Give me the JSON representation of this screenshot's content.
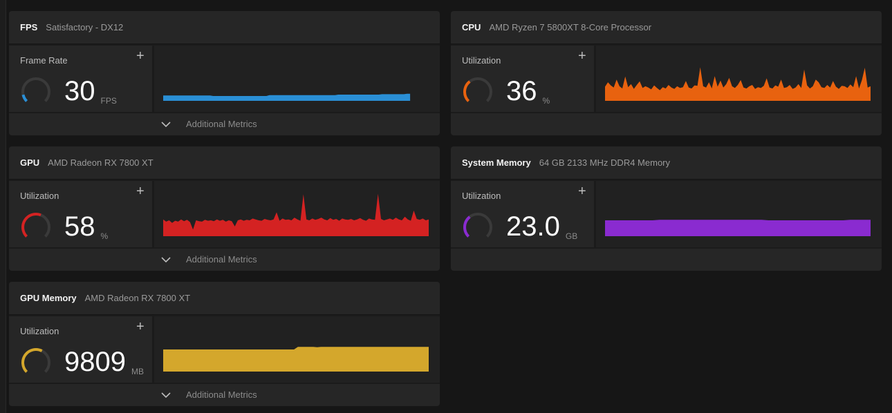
{
  "cards": {
    "fps": {
      "title": "FPS",
      "subtitle": "Satisfactory - DX12",
      "metric_label": "Frame Rate",
      "value": "30",
      "unit": "FPS",
      "gauge_fraction": 0.12,
      "color": "#2a8fd6",
      "graph_values": [
        0.12,
        0.12,
        0.12,
        0.12,
        0.12,
        0.12,
        0.12,
        0.12,
        0.12,
        0.12,
        0.12,
        0.12,
        0.12,
        0.12,
        0.12,
        0.12,
        0.11,
        0.11,
        0.11,
        0.11,
        0.11,
        0.11,
        0.11,
        0.11,
        0.11,
        0.11,
        0.11,
        0.11,
        0.11,
        0.11,
        0.11,
        0.11,
        0.11,
        0.11,
        0.13,
        0.13,
        0.13,
        0.13,
        0.13,
        0.13,
        0.13,
        0.13,
        0.13,
        0.13,
        0.13,
        0.13,
        0.13,
        0.13,
        0.13,
        0.13,
        0.13,
        0.13,
        0.13,
        0.13,
        0.13,
        0.13,
        0.14,
        0.14,
        0.14,
        0.14,
        0.14,
        0.14,
        0.14,
        0.14,
        0.14,
        0.14,
        0.14,
        0.14,
        0.14,
        0.14,
        0.15,
        0.15,
        0.15,
        0.15,
        0.15,
        0.15,
        0.15,
        0.15,
        0.16,
        0.16
      ],
      "graph_fill": 0.93,
      "has_footer": true
    },
    "cpu": {
      "title": "CPU",
      "subtitle": "AMD Ryzen 7 5800XT 8-Core Processor",
      "metric_label": "Utilization",
      "value": "36",
      "unit": "%",
      "gauge_fraction": 0.36,
      "color": "#e8620f",
      "graph_values": [
        0.32,
        0.42,
        0.35,
        0.3,
        0.48,
        0.33,
        0.28,
        0.55,
        0.31,
        0.38,
        0.27,
        0.36,
        0.44,
        0.29,
        0.33,
        0.3,
        0.26,
        0.35,
        0.29,
        0.24,
        0.31,
        0.28,
        0.36,
        0.3,
        0.27,
        0.33,
        0.29,
        0.31,
        0.45,
        0.3,
        0.28,
        0.35,
        0.34,
        0.76,
        0.33,
        0.3,
        0.42,
        0.28,
        0.56,
        0.32,
        0.46,
        0.3,
        0.38,
        0.52,
        0.33,
        0.29,
        0.36,
        0.47,
        0.3,
        0.28,
        0.33,
        0.36,
        0.27,
        0.31,
        0.29,
        0.34,
        0.51,
        0.3,
        0.28,
        0.35,
        0.32,
        0.48,
        0.29,
        0.31,
        0.36,
        0.27,
        0.3,
        0.38,
        0.29,
        0.71,
        0.35,
        0.28,
        0.33,
        0.48,
        0.42,
        0.31,
        0.29,
        0.36,
        0.3,
        0.45,
        0.32,
        0.27,
        0.34,
        0.33,
        0.29,
        0.37,
        0.31,
        0.56,
        0.28,
        0.47,
        0.75,
        0.3,
        0.33
      ],
      "graph_fill": 1.0,
      "has_footer": false
    },
    "gpu": {
      "title": "GPU",
      "subtitle": "AMD Radeon RX 7800 XT",
      "metric_label": "Utilization",
      "value": "58",
      "unit": "%",
      "gauge_fraction": 0.58,
      "color": "#d42222",
      "graph_values": [
        0.38,
        0.33,
        0.36,
        0.3,
        0.35,
        0.33,
        0.38,
        0.34,
        0.37,
        0.32,
        0.15,
        0.36,
        0.34,
        0.33,
        0.37,
        0.35,
        0.36,
        0.34,
        0.38,
        0.35,
        0.37,
        0.33,
        0.36,
        0.34,
        0.22,
        0.36,
        0.38,
        0.35,
        0.37,
        0.36,
        0.4,
        0.38,
        0.36,
        0.35,
        0.39,
        0.37,
        0.36,
        0.38,
        0.54,
        0.35,
        0.4,
        0.37,
        0.38,
        0.36,
        0.42,
        0.38,
        0.35,
        0.95,
        0.38,
        0.36,
        0.4,
        0.37,
        0.39,
        0.42,
        0.38,
        0.36,
        0.41,
        0.37,
        0.39,
        0.35,
        0.4,
        0.38,
        0.37,
        0.39,
        0.36,
        0.38,
        0.41,
        0.37,
        0.35,
        0.4,
        0.38,
        0.37,
        0.96,
        0.39,
        0.36,
        0.38,
        0.4,
        0.37,
        0.42,
        0.38,
        0.36,
        0.44,
        0.38,
        0.35,
        0.58,
        0.39,
        0.37,
        0.4,
        0.36,
        0.38
      ],
      "graph_fill": 1.0,
      "has_footer": true
    },
    "sysmem": {
      "title": "System Memory",
      "subtitle": "64 GB 2133 MHz DDR4 Memory",
      "metric_label": "Utilization",
      "value": "23.0",
      "unit": "GB",
      "gauge_fraction": 0.36,
      "color": "#8a2bd0",
      "graph_values": [
        0.36,
        0.36,
        0.36,
        0.36,
        0.36,
        0.36,
        0.36,
        0.36,
        0.37,
        0.37,
        0.37,
        0.37,
        0.37,
        0.37,
        0.37,
        0.37,
        0.37,
        0.37,
        0.37,
        0.37,
        0.37,
        0.37,
        0.37,
        0.37,
        0.36,
        0.36,
        0.36,
        0.36,
        0.36,
        0.36,
        0.36,
        0.36,
        0.36,
        0.36,
        0.36,
        0.36,
        0.37,
        0.37,
        0.37,
        0.37
      ],
      "graph_fill": 1.0,
      "has_footer": false
    },
    "gpumem": {
      "title": "GPU Memory",
      "subtitle": "AMD Radeon RX 7800 XT",
      "metric_label": "Utilization",
      "value": "9809",
      "unit": "MB",
      "gauge_fraction": 0.6,
      "color": "#d4a72c",
      "graph_values": [
        0.5,
        0.5,
        0.5,
        0.5,
        0.5,
        0.5,
        0.5,
        0.5,
        0.5,
        0.5,
        0.5,
        0.5,
        0.5,
        0.5,
        0.5,
        0.5,
        0.5,
        0.5,
        0.5,
        0.5,
        0.5,
        0.5,
        0.5,
        0.5,
        0.5,
        0.5,
        0.5,
        0.5,
        0.5,
        0.5,
        0.5,
        0.5,
        0.5,
        0.5,
        0.5,
        0.56,
        0.56,
        0.56,
        0.56,
        0.56,
        0.55,
        0.56,
        0.56,
        0.56,
        0.56,
        0.56,
        0.56,
        0.56,
        0.56,
        0.56,
        0.56,
        0.56,
        0.56,
        0.56,
        0.56,
        0.56,
        0.56,
        0.56,
        0.56,
        0.56,
        0.56,
        0.56,
        0.56,
        0.56,
        0.56,
        0.56,
        0.56,
        0.56,
        0.56,
        0.56
      ],
      "graph_fill": 1.0,
      "has_footer": true
    }
  },
  "footer_label": "Additional Metrics"
}
